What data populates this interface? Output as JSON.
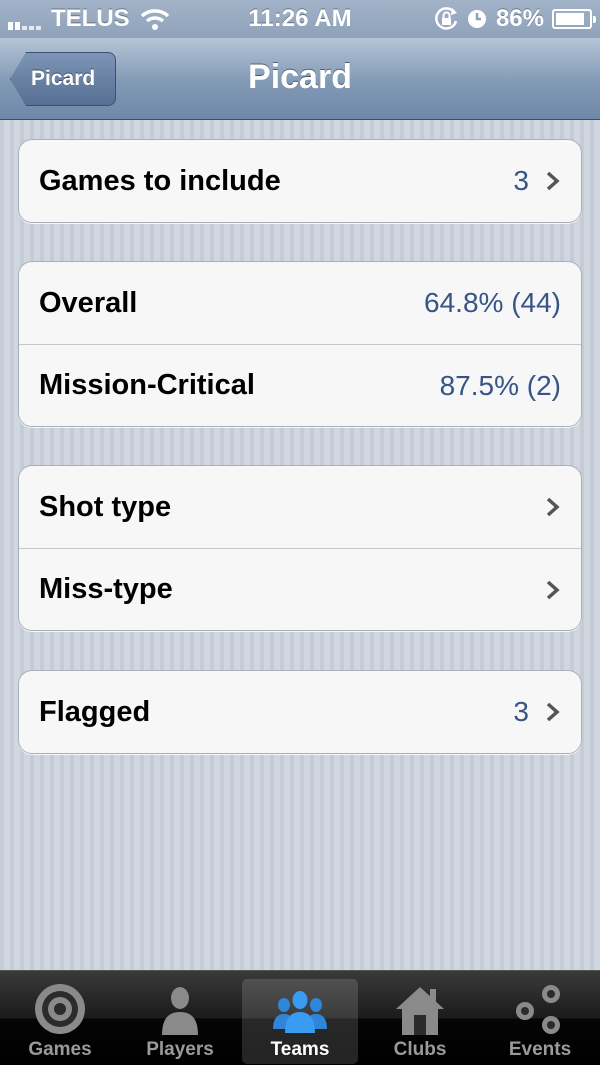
{
  "status_bar": {
    "carrier": "TELUS",
    "time": "11:26 AM",
    "battery": "86%"
  },
  "nav": {
    "back_label": "Picard",
    "title": "Picard"
  },
  "groups": [
    {
      "cells": [
        {
          "label": "Games to include",
          "value": "3"
        }
      ]
    },
    {
      "cells": [
        {
          "label": "Overall",
          "value": "64.8% (44)"
        },
        {
          "label": "Mission-Critical",
          "value": "87.5% (2)"
        }
      ]
    },
    {
      "cells": [
        {
          "label": "Shot type"
        },
        {
          "label": "Miss-type"
        }
      ]
    },
    {
      "cells": [
        {
          "label": "Flagged",
          "value": "3"
        }
      ]
    }
  ],
  "tabs": [
    {
      "label": "Games",
      "icon": "target-icon"
    },
    {
      "label": "Players",
      "icon": "person-icon"
    },
    {
      "label": "Teams",
      "icon": "team-icon",
      "active": true
    },
    {
      "label": "Clubs",
      "icon": "house-icon"
    },
    {
      "label": "Events",
      "icon": "circles-icon"
    }
  ],
  "colors": {
    "value_text": "#385487",
    "active_tab_icon": "#3a9bf2"
  }
}
